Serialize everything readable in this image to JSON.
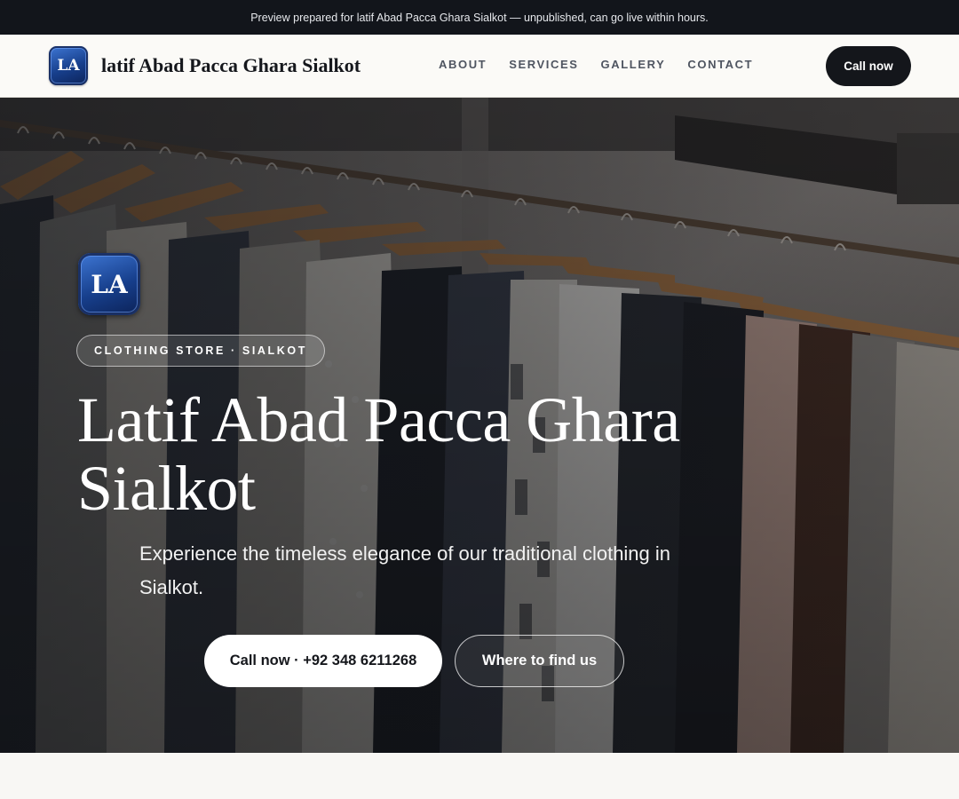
{
  "banner": {
    "text": "Preview prepared for latif Abad Pacca Ghara Sialkot — unpublished, can go live within hours."
  },
  "header": {
    "logo_text": "LA",
    "brand_name": "latif Abad Pacca Ghara Sialkot",
    "nav": [
      "ABOUT",
      "SERVICES",
      "GALLERY",
      "CONTACT"
    ],
    "cta_label": "Call now"
  },
  "hero": {
    "logo_text": "LA",
    "category": "CLOTHING STORE · SIALKOT",
    "title": "Latif Abad Pacca Ghara Sialkot",
    "subtitle": "Experience the timeless elegance of our traditional clothing in Sialkot.",
    "primary_button": "Call now · +92 348 6211268",
    "secondary_button": "Where to find us",
    "background_image": "clothing rack with garments on wooden hangers"
  },
  "colors": {
    "banner_bg": "#12151b",
    "header_bg": "#fbfaf7",
    "dark_button": "#14161b",
    "logo_blue": "#1f4fa8",
    "page_bg": "#f8f7f4"
  }
}
